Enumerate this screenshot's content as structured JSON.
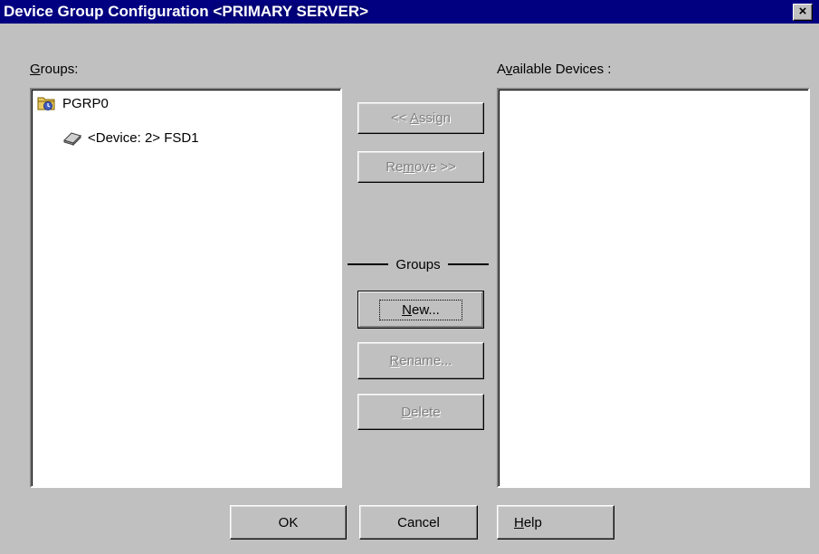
{
  "window": {
    "title": "Device Group Configuration",
    "server": "<PRIMARY SERVER>",
    "close_glyph": "×"
  },
  "groups_panel": {
    "label_prefix": "",
    "label_mnemonic": "G",
    "label_rest": "roups:",
    "tree": [
      {
        "label": "PGRP0",
        "icon": "folder-icon"
      },
      {
        "label": "<Device: 2> FSD1",
        "icon": "drive-icon"
      }
    ]
  },
  "devices_panel": {
    "label_prefix": "A",
    "label_mnemonic": "v",
    "label_rest": "ailable Devices :"
  },
  "buttons": {
    "assign": {
      "pre": "<< ",
      "mn": "A",
      "post": "ssign",
      "enabled": false
    },
    "remove": {
      "pre": "Re",
      "mn": "m",
      "post": "ove >>",
      "enabled": false
    },
    "groups_heading": "Groups",
    "new": {
      "pre": "",
      "mn": "N",
      "post": "ew...",
      "enabled": true
    },
    "rename": {
      "pre": "",
      "mn": "R",
      "post": "ename...",
      "enabled": false
    },
    "delete": {
      "pre": "",
      "mn": "D",
      "post": "elete",
      "enabled": false
    },
    "ok": "OK",
    "cancel": "Cancel",
    "help": {
      "pre": "",
      "mn": "H",
      "post": "elp"
    }
  }
}
